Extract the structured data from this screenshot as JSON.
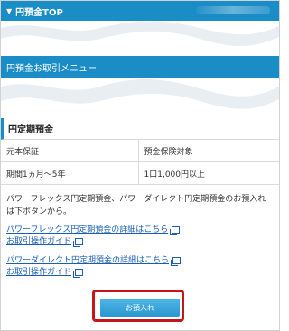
{
  "header": {
    "title": "円預金TOP",
    "toggle_icon": "triangle-down-icon"
  },
  "menu_bar": {
    "title": "円預金お取引メニュー"
  },
  "section": {
    "title": "円定期預金"
  },
  "info_table": [
    {
      "left": "元本保証",
      "right": "預金保険対象"
    },
    {
      "left": "期間1ヵ月〜5年",
      "right": "1口1,000円以上"
    }
  ],
  "description": "パワーフレックス円定期預金、パワーダイレクト円定期預金のお預入れは下ボタンから。",
  "links": {
    "group1": {
      "detail": "パワーフレックス円定期預金の詳細はこちら",
      "guide": "お取引操作ガイド"
    },
    "group2": {
      "detail": "パワーダイレクト円定期預金の詳細はこちら",
      "guide": "お取引操作ガイド"
    }
  },
  "deposit_button": {
    "label": "お預入れ"
  },
  "colors": {
    "accent": "#1a8cc6",
    "link": "#1a5fb4",
    "highlight": "#c4161c"
  }
}
